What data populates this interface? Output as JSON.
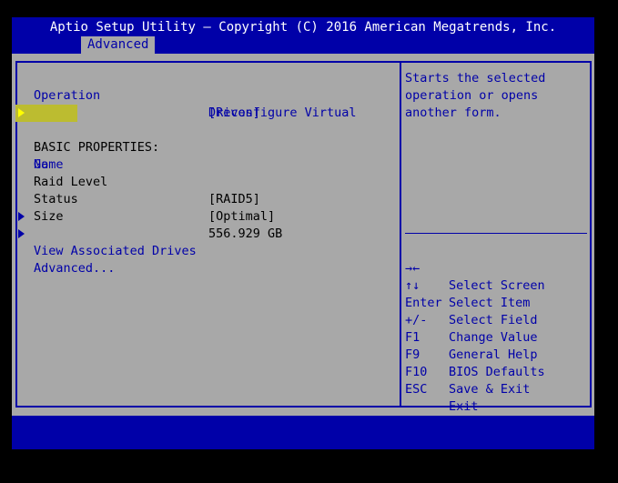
{
  "header": {
    "title": "Aptio Setup Utility – Copyright (C) 2016 American Megatrends, Inc.",
    "active_tab": "Advanced"
  },
  "items": {
    "operation_label": "Operation",
    "operation_value_line1": "[Reconfigure Virtual",
    "operation_value_line2": "Drives]",
    "go_label": "Go",
    "basic_properties": "BASIC PROPERTIES:",
    "name_label": "Name",
    "raid_level_label": "Raid Level",
    "raid_level_value": "[RAID5]",
    "status_label": "Status",
    "status_value": "[Optimal]",
    "size_label": "Size",
    "size_value": "556.929 GB",
    "view_drives_label": "View Associated Drives",
    "advanced_label": "Advanced..."
  },
  "help": {
    "line1": "Starts the selected",
    "line2": "operation or opens",
    "line3": "another form."
  },
  "keys": [
    {
      "key": "→←",
      "desc": "Select Screen"
    },
    {
      "key": "↑↓",
      "desc": "Select Item"
    },
    {
      "key": "Enter",
      "desc": "Select Field"
    },
    {
      "key": "+/-",
      "desc": "Change Value"
    },
    {
      "key": "F1",
      "desc": "General Help"
    },
    {
      "key": "F9",
      "desc": "BIOS Defaults"
    },
    {
      "key": "F10",
      "desc": "Save & Exit"
    },
    {
      "key": "ESC",
      "desc": "Exit"
    }
  ],
  "colors": {
    "background": "#a8a8a8",
    "accent": "#0000a8",
    "selection": "#bcbc30",
    "screen": "#000000"
  }
}
